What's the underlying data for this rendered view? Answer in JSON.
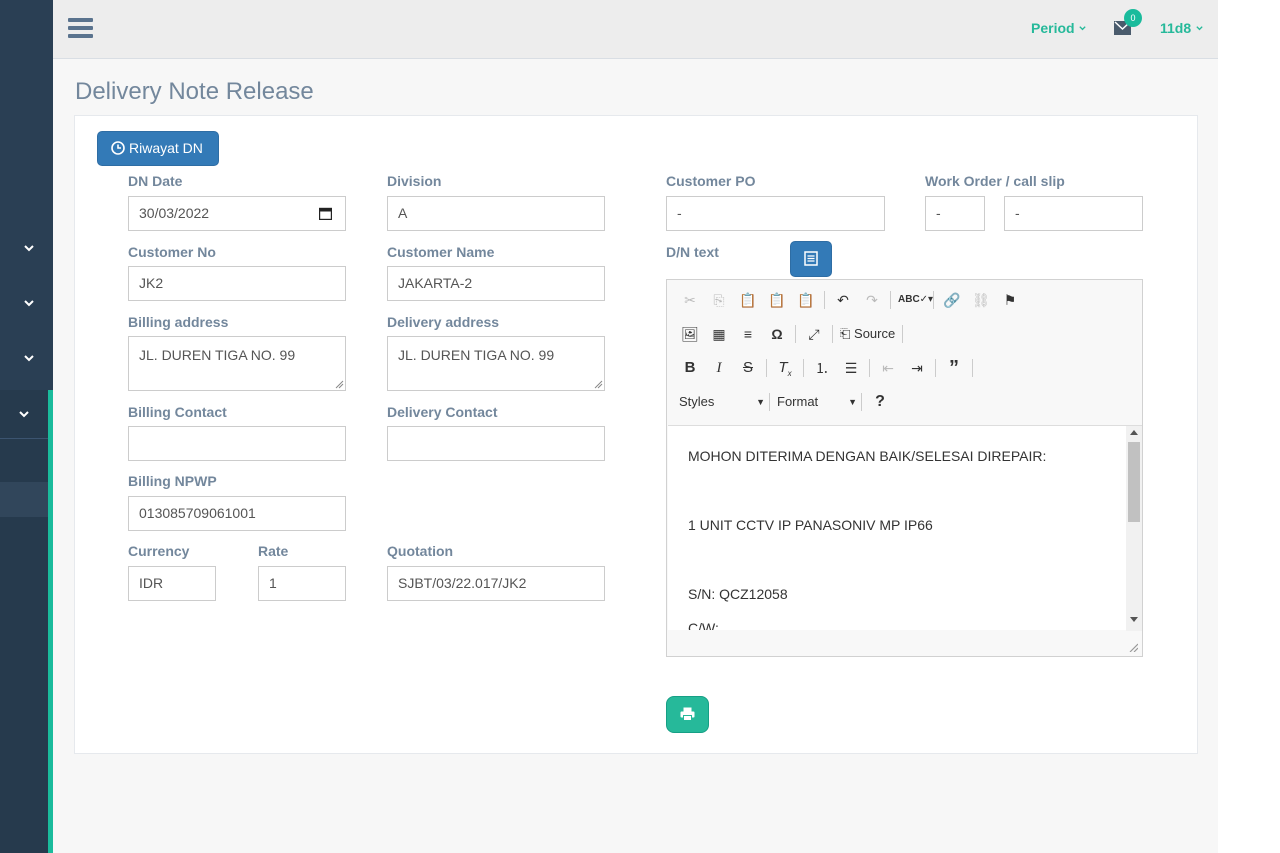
{
  "topbar": {
    "period_label": "Period",
    "mail_badge": "0",
    "user_label": "11d8"
  },
  "page_title": "Delivery Note Release",
  "buttons": {
    "history": "Riwayat DN"
  },
  "form": {
    "dn_date": {
      "label": "DN Date",
      "value": "30/03/2022"
    },
    "division": {
      "label": "Division",
      "value": "A"
    },
    "customer_po": {
      "label": "Customer PO",
      "value": "-"
    },
    "work_order": {
      "label": "Work Order / call slip",
      "value1": "-",
      "value2": "-"
    },
    "customer_no": {
      "label": "Customer No",
      "value": "JK2"
    },
    "customer_name": {
      "label": "Customer Name",
      "value": "JAKARTA-2"
    },
    "dn_text": {
      "label": "D/N text"
    },
    "billing_address": {
      "label": "Billing address",
      "value": "JL. DUREN TIGA NO. 99"
    },
    "delivery_address": {
      "label": "Delivery address",
      "value": "JL. DUREN TIGA NO. 99"
    },
    "billing_contact": {
      "label": "Billing Contact",
      "value": ""
    },
    "delivery_contact": {
      "label": "Delivery Contact",
      "value": ""
    },
    "billing_npwp": {
      "label": "Billing NPWP",
      "value": "013085709061001"
    },
    "currency": {
      "label": "Currency",
      "value": "IDR"
    },
    "rate": {
      "label": "Rate",
      "value": "1"
    },
    "quotation": {
      "label": "Quotation",
      "value": "SJBT/03/22.017/JK2"
    }
  },
  "editor": {
    "source_label": "Source",
    "styles_label": "Styles",
    "format_label": "Format",
    "help_label": "?",
    "lines": [
      "MOHON DITERIMA DENGAN BAIK/SELESAI DIREPAIR:",
      "1 UNIT CCTV IP PANASONIV MP IP66",
      "S/N: QCZ12058",
      "C/W:"
    ]
  },
  "colors": {
    "sidebar": "#2a3f54",
    "accent": "#1abb9c",
    "primary_button": "#337ab7",
    "label": "#73879c"
  }
}
